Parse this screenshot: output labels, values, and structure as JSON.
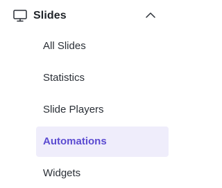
{
  "menu": {
    "group": {
      "label": "Slides",
      "icon": "monitor-icon",
      "toggle_icon": "chevron-up-icon",
      "expanded": true
    },
    "items": [
      {
        "label": "All Slides",
        "active": false
      },
      {
        "label": "Statistics",
        "active": false
      },
      {
        "label": "Slide Players",
        "active": false
      },
      {
        "label": "Automations",
        "active": true
      },
      {
        "label": "Widgets",
        "active": false
      }
    ]
  },
  "colors": {
    "text": "#2a2f36",
    "heading": "#1f2328",
    "accent": "#5b4bd1",
    "active_bg": "#efedfb"
  }
}
